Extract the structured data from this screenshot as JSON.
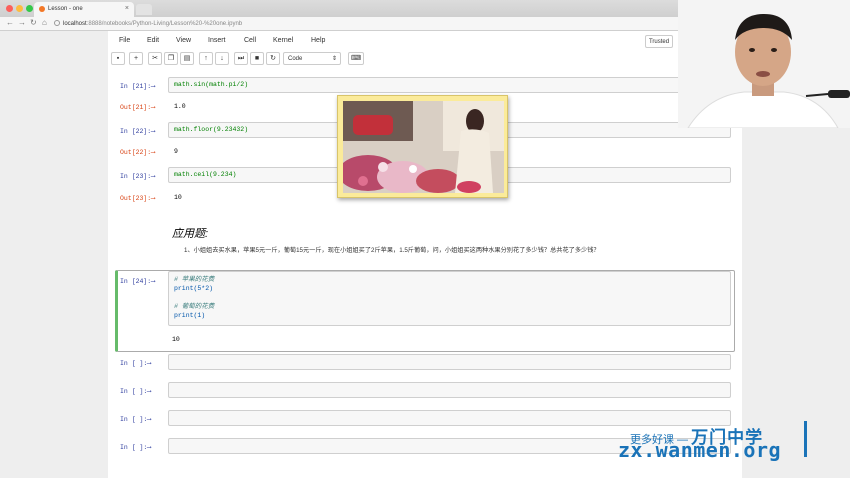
{
  "browser": {
    "tab_title": "Lesson - one",
    "tab_close": "×",
    "url_host": "localhost",
    "url_rest": ":8888/notebooks/Python-Living/Lesson%20-%20one.ipynb"
  },
  "menu": [
    "File",
    "Edit",
    "View",
    "Insert",
    "Cell",
    "Kernel",
    "Help"
  ],
  "trusted": "Trusted",
  "toolbar": {
    "cell_type": "Code"
  },
  "cells": [
    {
      "in_prompt": "In [21]:⟶",
      "code": "math.sin(math.pi/2)",
      "out_prompt": "Out[21]:⟶",
      "output": "1.0"
    },
    {
      "in_prompt": "In [22]:⟶",
      "code": "math.floor(9.23432)",
      "out_prompt": "Out[22]:⟶",
      "output": "9"
    },
    {
      "in_prompt": "In [23]:⟶",
      "code": "math.ceil(9.234)",
      "out_prompt": "Out[23]:⟶",
      "output": "10"
    }
  ],
  "markdown": {
    "title": "应用题:",
    "text": "1、小姐姐去买水果，苹果5元一斤，葡萄15元一斤，现在小姐姐买了2斤苹果，1.5斤葡萄，问，小姐姐买这两种水果分别花了多少钱？总共花了多少钱？"
  },
  "active_cell": {
    "in_prompt": "In [24]:⟶",
    "line1": "# 苹果的花费",
    "line2": "print(5*2)",
    "line3": "# 葡萄的花费",
    "line4": "print(1)",
    "output": "10"
  },
  "empty_cells": [
    "In [ ]:⟶",
    "In [ ]:⟶",
    "In [ ]:⟶",
    "In [ ]:⟶"
  ],
  "watermark": {
    "line1": "更多好课 —",
    "brand": "万门中学",
    "line2": "zx.wanmen.org"
  }
}
